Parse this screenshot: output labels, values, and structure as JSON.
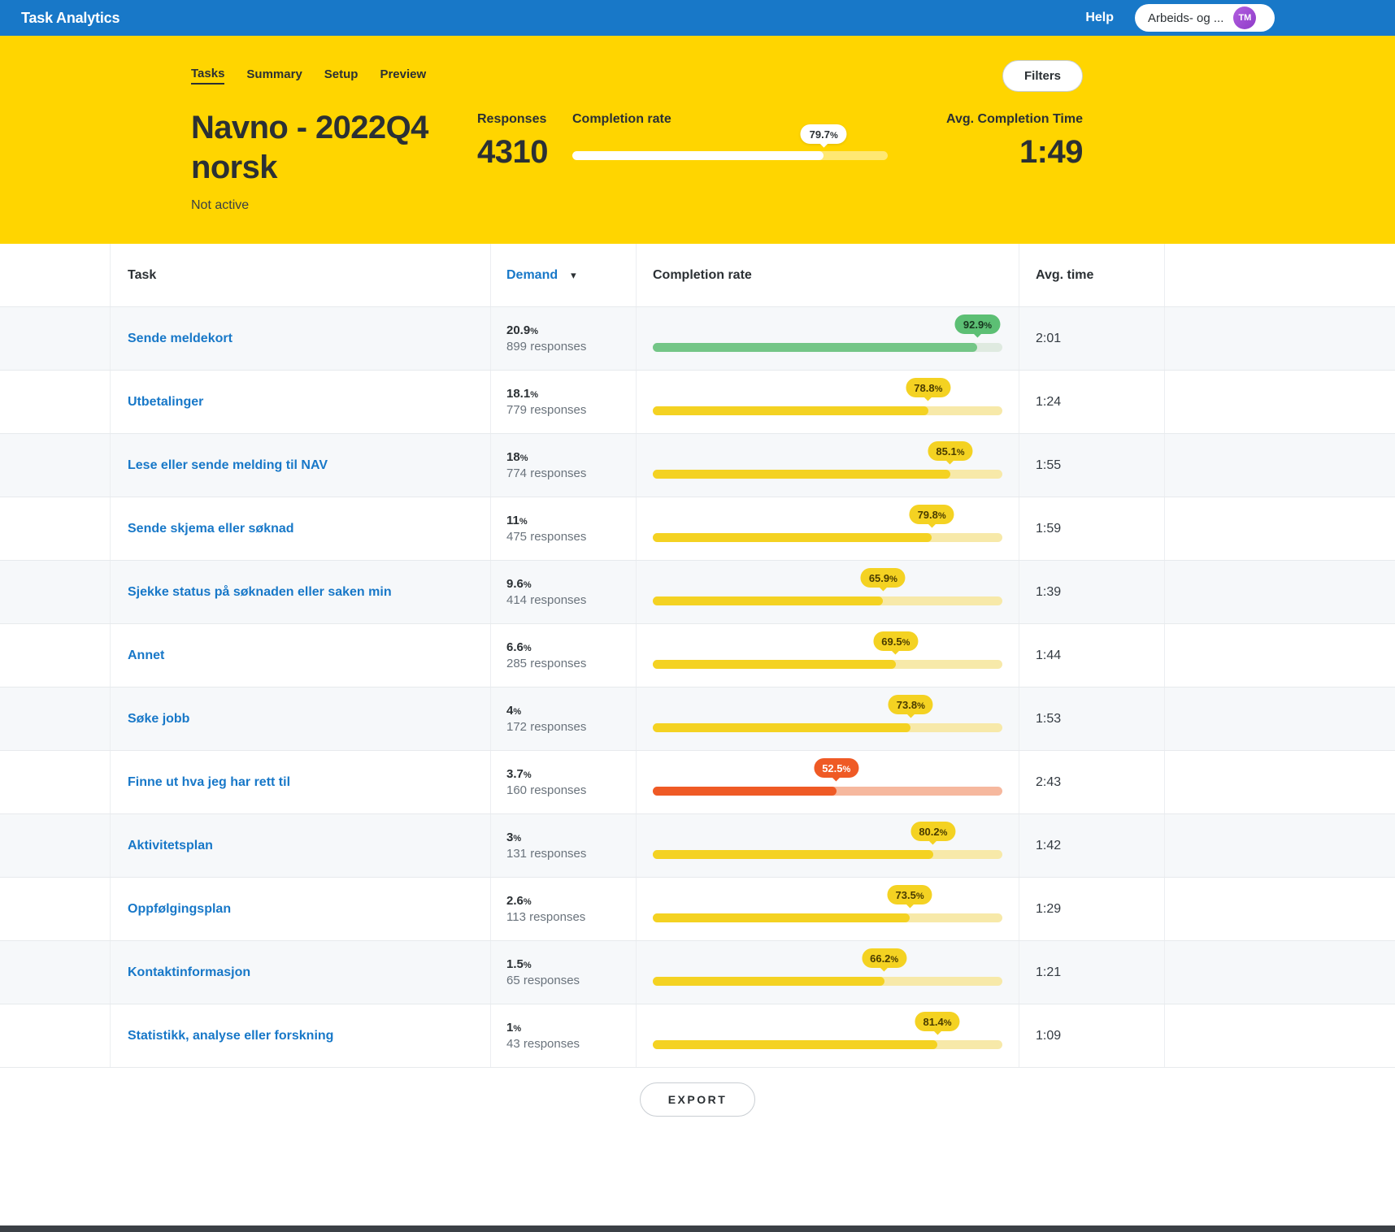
{
  "percent_symbol": "%",
  "topbar": {
    "brand": "Task Analytics",
    "help": "Help",
    "account": "Arbeids- og ...",
    "avatar_initials": "TM"
  },
  "header": {
    "tabs": [
      {
        "label": "Tasks",
        "active": true
      },
      {
        "label": "Summary",
        "active": false
      },
      {
        "label": "Setup",
        "active": false
      },
      {
        "label": "Preview",
        "active": false
      }
    ],
    "filters_button": "Filters",
    "title": "Navno - 2022Q4 norsk",
    "status": "Not active",
    "responses": {
      "label": "Responses",
      "value": "4310"
    },
    "completion": {
      "label": "Completion rate",
      "value": "79.7"
    },
    "avg_time": {
      "label": "Avg. Completion Time",
      "value": "1:49"
    }
  },
  "table": {
    "headers": {
      "task": "Task",
      "demand": "Demand",
      "completion": "Completion rate",
      "avg": "Avg. time"
    },
    "rows": [
      {
        "task": "Sende meldekort",
        "demand_pct": "20.9",
        "responses": "899 responses",
        "completion_pct": "92.9",
        "avg_time": "2:01",
        "tone": "green"
      },
      {
        "task": "Utbetalinger",
        "demand_pct": "18.1",
        "responses": "779 responses",
        "completion_pct": "78.8",
        "avg_time": "1:24",
        "tone": "yellow"
      },
      {
        "task": "Lese eller sende melding til NAV",
        "demand_pct": "18",
        "responses": "774 responses",
        "completion_pct": "85.1",
        "avg_time": "1:55",
        "tone": "yellow"
      },
      {
        "task": "Sende skjema eller søknad",
        "demand_pct": "11",
        "responses": "475 responses",
        "completion_pct": "79.8",
        "avg_time": "1:59",
        "tone": "yellow"
      },
      {
        "task": "Sjekke status på søknaden eller saken min",
        "demand_pct": "9.6",
        "responses": "414 responses",
        "completion_pct": "65.9",
        "avg_time": "1:39",
        "tone": "yellow"
      },
      {
        "task": "Annet",
        "demand_pct": "6.6",
        "responses": "285 responses",
        "completion_pct": "69.5",
        "avg_time": "1:44",
        "tone": "yellow"
      },
      {
        "task": "Søke jobb",
        "demand_pct": "4",
        "responses": "172 responses",
        "completion_pct": "73.8",
        "avg_time": "1:53",
        "tone": "yellow"
      },
      {
        "task": "Finne ut hva jeg har rett til",
        "demand_pct": "3.7",
        "responses": "160 responses",
        "completion_pct": "52.5",
        "avg_time": "2:43",
        "tone": "orange"
      },
      {
        "task": "Aktivitetsplan",
        "demand_pct": "3",
        "responses": "131 responses",
        "completion_pct": "80.2",
        "avg_time": "1:42",
        "tone": "yellow"
      },
      {
        "task": "Oppfølgingsplan",
        "demand_pct": "2.6",
        "responses": "113 responses",
        "completion_pct": "73.5",
        "avg_time": "1:29",
        "tone": "yellow"
      },
      {
        "task": "Kontaktinformasjon",
        "demand_pct": "1.5",
        "responses": "65 responses",
        "completion_pct": "66.2",
        "avg_time": "1:21",
        "tone": "yellow"
      },
      {
        "task": "Statistikk, analyse eller forskning",
        "demand_pct": "1",
        "responses": "43 responses",
        "completion_pct": "81.4",
        "avg_time": "1:09",
        "tone": "yellow"
      }
    ]
  },
  "footer": {
    "export_button": "EXPORT"
  },
  "colors": {
    "topbar_blue": "#1878c8",
    "header_yellow": "#ffd500",
    "link_blue": "#1878c8",
    "green": "#5cbf74",
    "yellow": "#f4d222",
    "orange": "#ef5a25"
  }
}
